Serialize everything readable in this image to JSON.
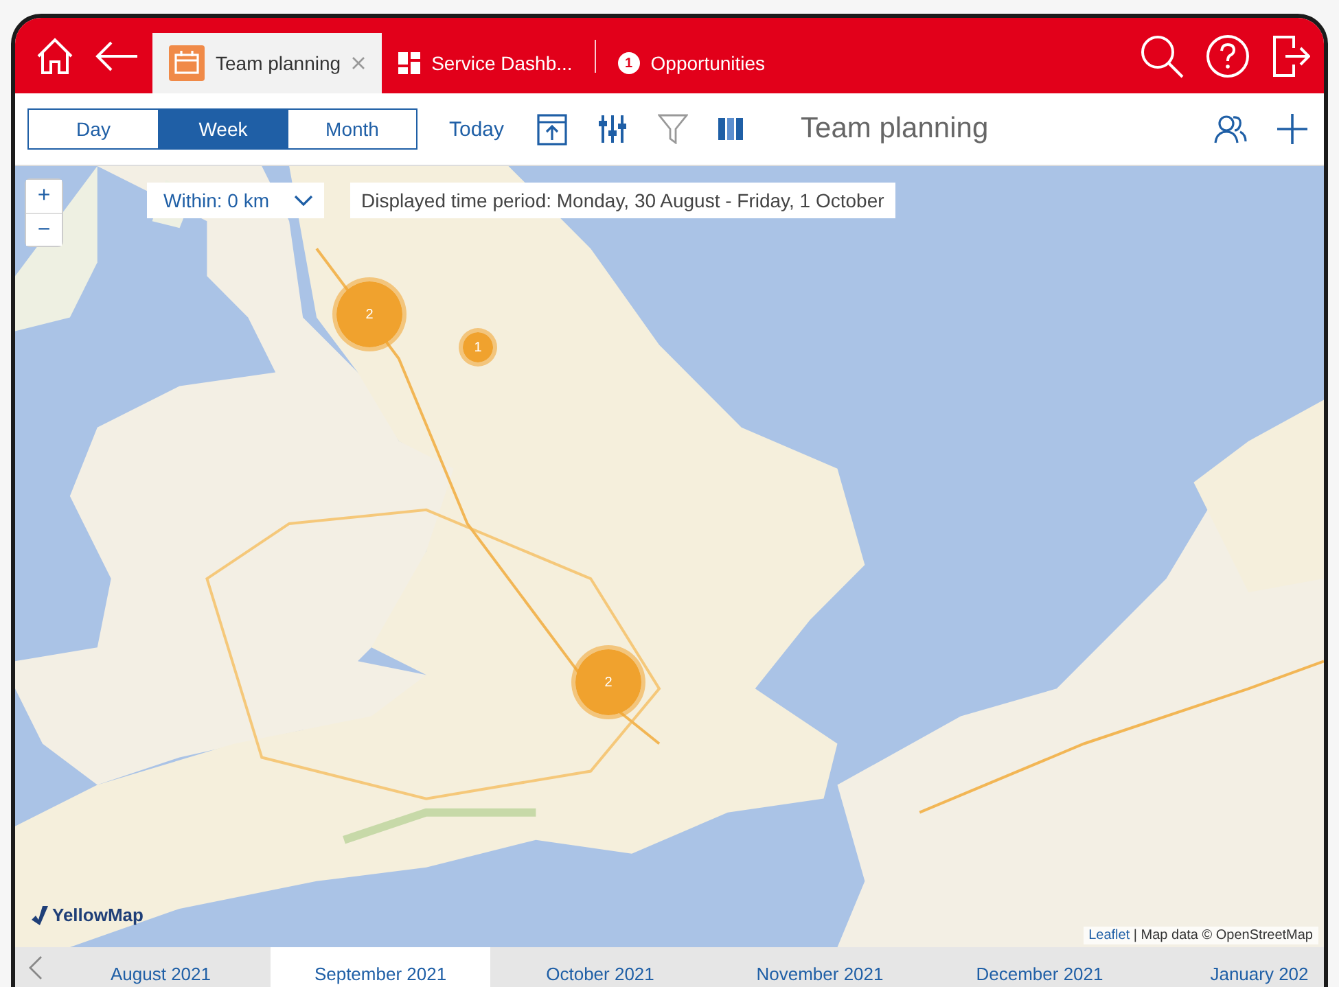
{
  "header": {
    "tabs": [
      {
        "label": "Team planning",
        "kind": "calendar",
        "closable": true,
        "selected": true
      },
      {
        "label": "Service Dashb...",
        "kind": "dashboard",
        "closable": false,
        "selected": false
      },
      {
        "label": "Opportunities",
        "kind": "badge",
        "badge": "1",
        "closable": false,
        "selected": false
      }
    ]
  },
  "toolbar": {
    "views": [
      {
        "label": "Day",
        "selected": false
      },
      {
        "label": "Week",
        "selected": true
      },
      {
        "label": "Month",
        "selected": false
      }
    ],
    "today": "Today",
    "title": "Team planning"
  },
  "map": {
    "zoom_in": "+",
    "zoom_out": "−",
    "radius": "Within: 0 km",
    "period": "Displayed time period: Monday, 30 August - Friday, 1 October",
    "clusters": [
      {
        "count": "2",
        "kind": "large"
      },
      {
        "count": "1",
        "kind": "small"
      },
      {
        "count": "2",
        "kind": "large"
      }
    ],
    "logo": "YellowMap",
    "attribution_link": "Leaflet",
    "attribution": "| Map data © OpenStreetMap"
  },
  "timeline": {
    "months": [
      {
        "label": "August 2021",
        "selected": false
      },
      {
        "label": "September 2021",
        "selected": true
      },
      {
        "label": "October 2021",
        "selected": false
      },
      {
        "label": "November 2021",
        "selected": false
      },
      {
        "label": "December 2021",
        "selected": false
      },
      {
        "label": "January 202",
        "selected": false
      }
    ]
  }
}
